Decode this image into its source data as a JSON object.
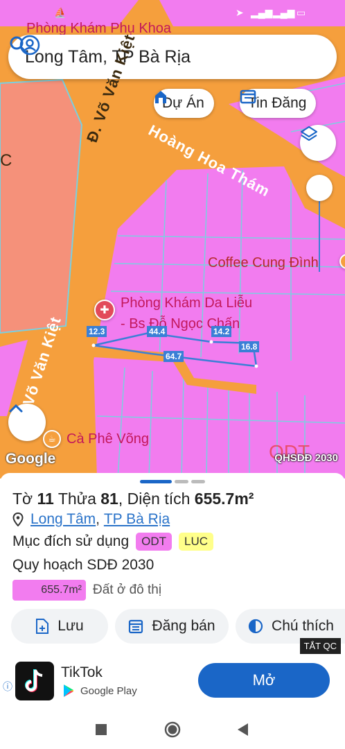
{
  "search": {
    "query": "Long Tâm, TP Bà Rịa"
  },
  "chips": {
    "du_an": "Dự Án",
    "tin_dang": "Tin Đăng"
  },
  "map": {
    "top_partial_label": "Phòng Khám Phụ Khoa",
    "road_vo_van_kiet_1": "Đ. Võ Văn Kiệt",
    "road_hoang_hoa_tham": "Hoàng Hoa Thám",
    "road_vo_van_kiet_2": "Võ Văn Kiệt",
    "left_edge_label": "C",
    "coffee": "Coffee Cung Đình",
    "clinic_line1": "Phòng Khám Da Liễu",
    "clinic_line2": "- Bs Đỗ Ngọc Chấn",
    "cafe": "Cà Phê Võng",
    "odt_watermark": "ODT",
    "dims": {
      "d1": "12.3",
      "d2": "44.4",
      "d3": "14.2",
      "d4": "16.8",
      "d5": "64.7"
    },
    "google": "Google",
    "layer_name": "QHSDĐ 2030"
  },
  "parcel": {
    "to_label": "Tờ",
    "to_value": "11",
    "thua_label": "Thửa",
    "thua_value": "81",
    "area_prefix": ", Diện tích",
    "area_value": "655.7m²",
    "ward": "Long Tâm",
    "city": "TP Bà Rịa",
    "purpose_label": "Mục đích sử dụng",
    "purpose_tags": [
      "ODT",
      "LUC"
    ],
    "plan_title": "Quy hoạch SDĐ 2030",
    "plan_area": "655.7m²",
    "plan_desc": "Đất ở đô thị"
  },
  "actions": {
    "save": "Lưu",
    "sell": "Đăng bán",
    "legend": "Chú thích"
  },
  "ad": {
    "close_label": "TẮT QC",
    "app_name": "TikTok",
    "store": "Google Play",
    "cta": "Mở"
  },
  "colors": {
    "odt_pink": "#f27cef",
    "road_orange": "#f59f3d",
    "luc_yellow": "#ffff8a",
    "accent_blue": "#1a66c7",
    "parcel_blue": "#3a7fd6"
  }
}
